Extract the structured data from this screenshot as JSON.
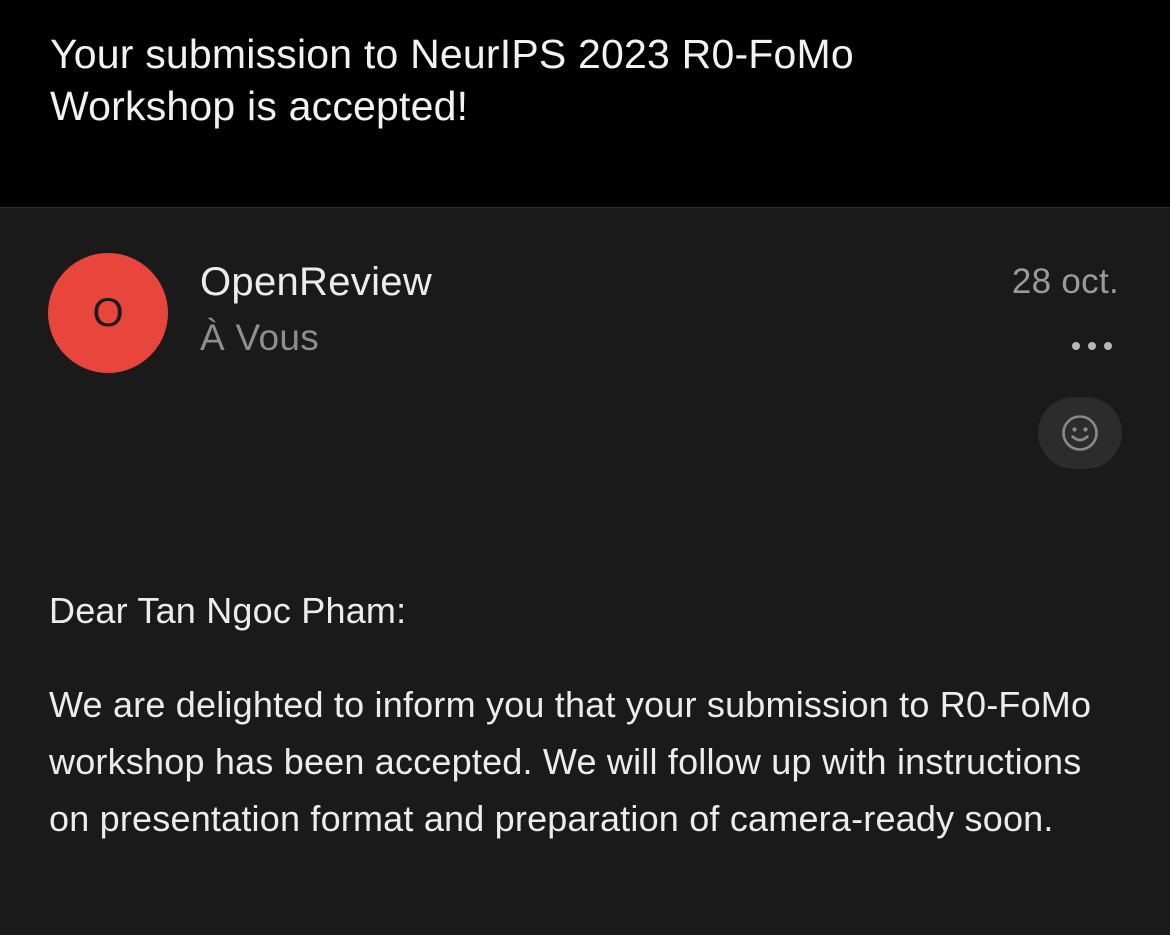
{
  "email": {
    "subject": "Your submission to NeurIPS 2023 R0-FoMo Workshop is accepted!",
    "sender": {
      "avatar_initial": "O",
      "avatar_color": "#e8453c",
      "name": "OpenReview",
      "recipient": "À Vous"
    },
    "date": "28 oct.",
    "actions": {
      "more_icon": "ellipsis-icon",
      "reaction_icon": "smiley-icon"
    },
    "body": {
      "greeting": "Dear Tan Ngoc Pham:",
      "paragraph": "We are delighted to inform you that your submission to R0-FoMo workshop has been accepted. We will follow up with instructions on presentation format and preparation of camera-ready soon."
    }
  }
}
